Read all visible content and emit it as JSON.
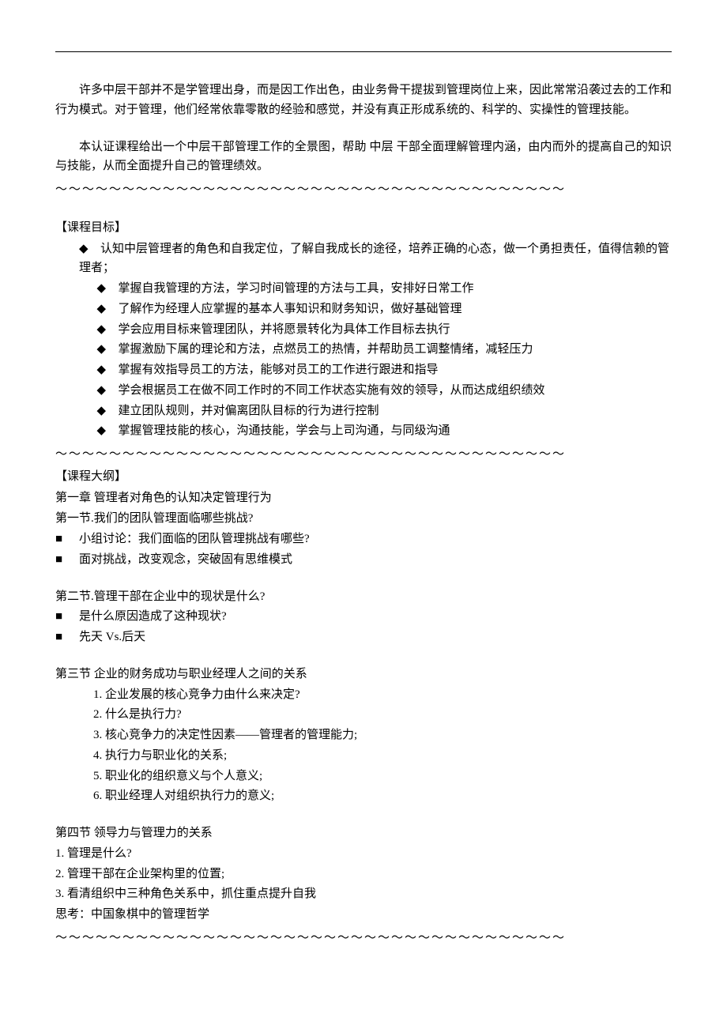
{
  "wave": "～～～～～～～～～～～～～～～～～～～～～～～～～～～～～～～～～～～～～～",
  "intro1": "许多中层干部并不是学管理出身，而是因工作出色，由业务骨干提拔到管理岗位上来，因此常常沿袭过去的工作和行为模式。对于管理，他们经常依靠零散的经验和感觉，并没有真正形成系统的、科学的、实操性的管理技能。",
  "intro2": "本认证课程给出一个中层干部管理工作的全景图，帮助 中层 干部全面理解管理内涵，由内而外的提高自己的知识与技能，从而全面提升自己的管理绩效。",
  "objectives": {
    "title": "【课程目标】",
    "first": "认知中层管理者的角色和自我定位，了解自我成长的途径，培养正确的心态，做一个勇担责任，值得信赖的管理者；",
    "items": [
      "掌握自我管理的方法，学习时间管理的方法与工具，安排好日常工作",
      "了解作为经理人应掌握的基本人事知识和财务知识，做好基础管理",
      "学会应用目标来管理团队，并将愿景转化为具体工作目标去执行",
      "掌握激励下属的理论和方法，点燃员工的热情，并帮助员工调整情绪，减轻压力",
      "掌握有效指导员工的方法，能够对员工的工作进行跟进和指导",
      "学会根据员工在做不同工作时的不同工作状态实施有效的领导，从而达成组织绩效",
      "建立团队规则，并对偏离团队目标的行为进行控制",
      "掌握管理技能的核心，沟通技能，学会与上司沟通，与同级沟通"
    ]
  },
  "outline": {
    "title": "【课程大纲】",
    "chapter1": "第一章 管理者对角色的认知决定管理行为",
    "s1": {
      "title": "第一节.我们的团队管理面临哪些挑战?",
      "items": [
        "小组讨论：我们面临的团队管理挑战有哪些?",
        "面对挑战，改变观念，突破固有思维模式"
      ]
    },
    "s2": {
      "title": "第二节.管理干部在企业中的现状是什么?",
      "items": [
        "是什么原因造成了这种现状?",
        "先天 Vs.后天"
      ]
    },
    "s3": {
      "title": "第三节  企业的财务成功与职业经理人之间的关系",
      "items": [
        "1. 企业发展的核心竞争力由什么来决定?",
        "2. 什么是执行力?",
        "3.  核心竞争力的决定性因素——管理者的管理能力;",
        "4.  执行力与职业化的关系;",
        "5.  职业化的组织意义与个人意义;",
        "6.  职业经理人对组织执行力的意义;"
      ]
    },
    "s4": {
      "title": "第四节  领导力与管理力的关系",
      "items": [
        "1.  管理是什么?",
        "2.  管理干部在企业架构里的位置;",
        "3.  看清组织中三种角色关系中，抓住重点提升自我"
      ],
      "note": "思考：中国象棋中的管理哲学"
    }
  }
}
